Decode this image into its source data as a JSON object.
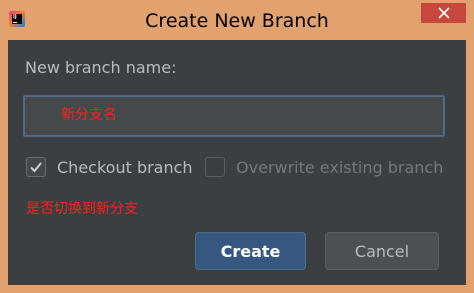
{
  "window": {
    "title": "Create New Branch",
    "app_icon_text": "IJ"
  },
  "form": {
    "name_label": "New branch name:",
    "name_value": "",
    "name_annotation": "新分支名",
    "checkout_label": "Checkout branch",
    "checkout_checked": true,
    "overwrite_label": "Overwrite existing branch",
    "overwrite_checked": false,
    "checkout_annotation": "是否切换到新分支"
  },
  "buttons": {
    "create_label": "Create",
    "cancel_label": "Cancel"
  },
  "colors": {
    "titlebar": "#e2a270",
    "dialog_bg": "#3c3f41",
    "close_button": "#c7463d",
    "primary_button": "#365880",
    "annotation_red": "#ff2020"
  },
  "icons": {
    "app": "intellij-idea-icon",
    "close": "close-icon",
    "check": "checkmark-icon"
  }
}
